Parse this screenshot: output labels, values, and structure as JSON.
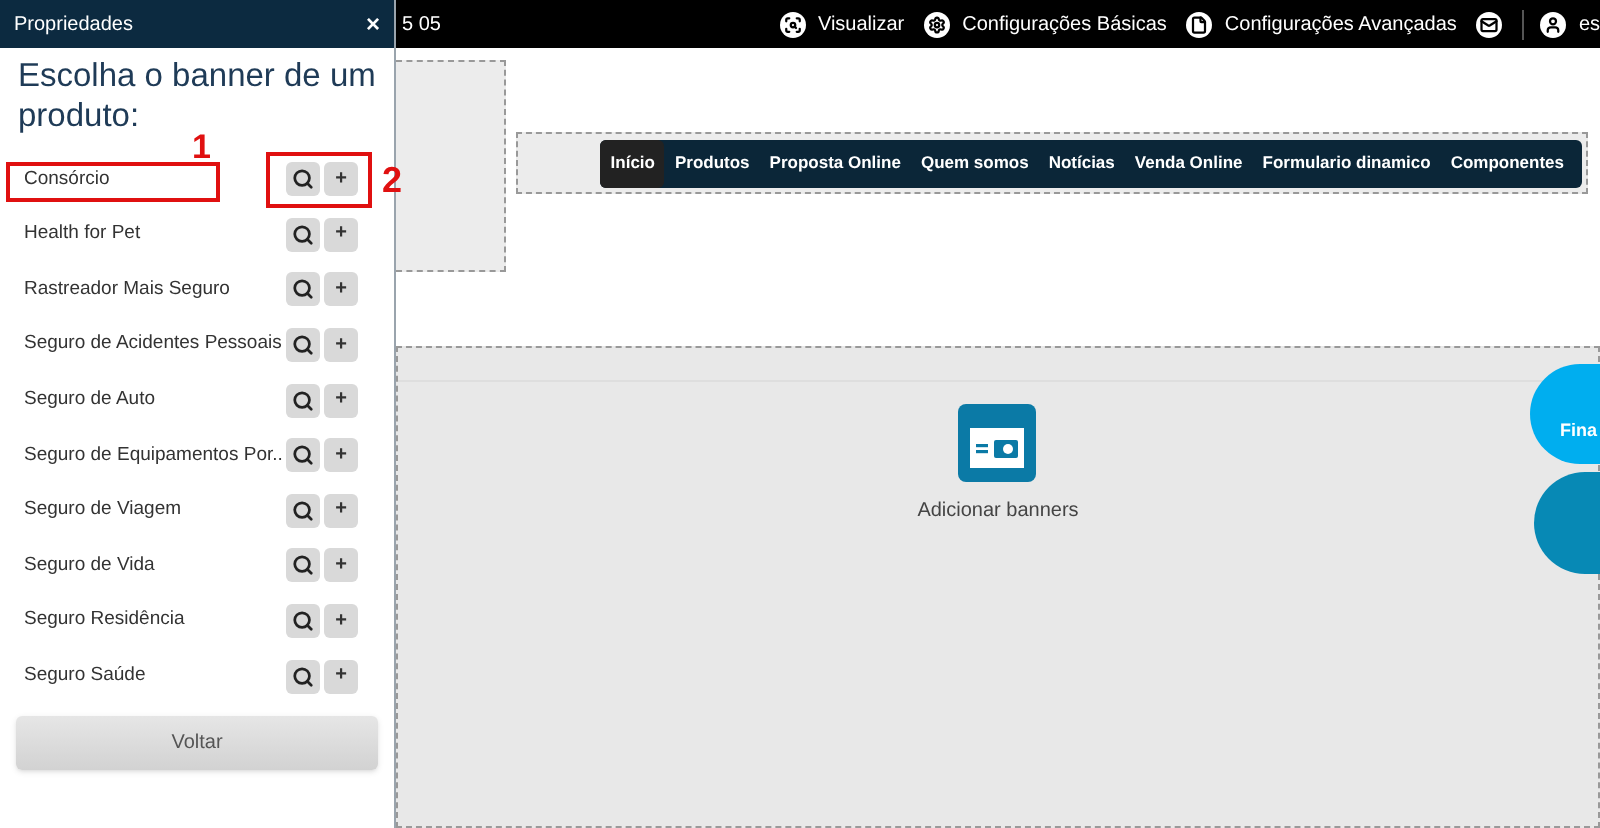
{
  "panel": {
    "title": "Propriedades",
    "close": "×",
    "heading": "Escolha o banner de um produto:",
    "items": [
      {
        "label": "Consórcio"
      },
      {
        "label": "Health for Pet"
      },
      {
        "label": "Rastreador Mais Seguro"
      },
      {
        "label": "Seguro de Acidentes Pessoais"
      },
      {
        "label": "Seguro de Auto"
      },
      {
        "label": "Seguro de Equipamentos Por.."
      },
      {
        "label": "Seguro de Viagem"
      },
      {
        "label": "Seguro de Vida"
      },
      {
        "label": "Seguro Residência"
      },
      {
        "label": "Seguro Saúde"
      }
    ],
    "add_symbol": "+",
    "back_button": "Voltar"
  },
  "annotations": [
    {
      "label": "1"
    },
    {
      "label": "2"
    }
  ],
  "top_bar": {
    "partial_text": "5 05",
    "actions": [
      {
        "kind": "preview",
        "label": "Visualizar"
      },
      {
        "kind": "settings",
        "label": "Configurações Básicas"
      },
      {
        "kind": "file",
        "label": "Configurações Avançadas"
      },
      {
        "kind": "mail"
      },
      {
        "kind": "user",
        "label": "es"
      }
    ]
  },
  "site_menu": [
    {
      "label": "Início",
      "selected": true
    },
    {
      "label": "Produtos",
      "selected": false
    },
    {
      "label": "Proposta Online",
      "selected": false
    },
    {
      "label": "Quem somos",
      "selected": false
    },
    {
      "label": "Notícias",
      "selected": false
    },
    {
      "label": "Venda Online",
      "selected": false
    },
    {
      "label": "Formulario dinamico",
      "selected": false
    },
    {
      "label": "Componentes",
      "selected": false
    }
  ],
  "banner_area": {
    "label": "Adicionar banners"
  },
  "floating_button": {
    "label": "Fina"
  }
}
